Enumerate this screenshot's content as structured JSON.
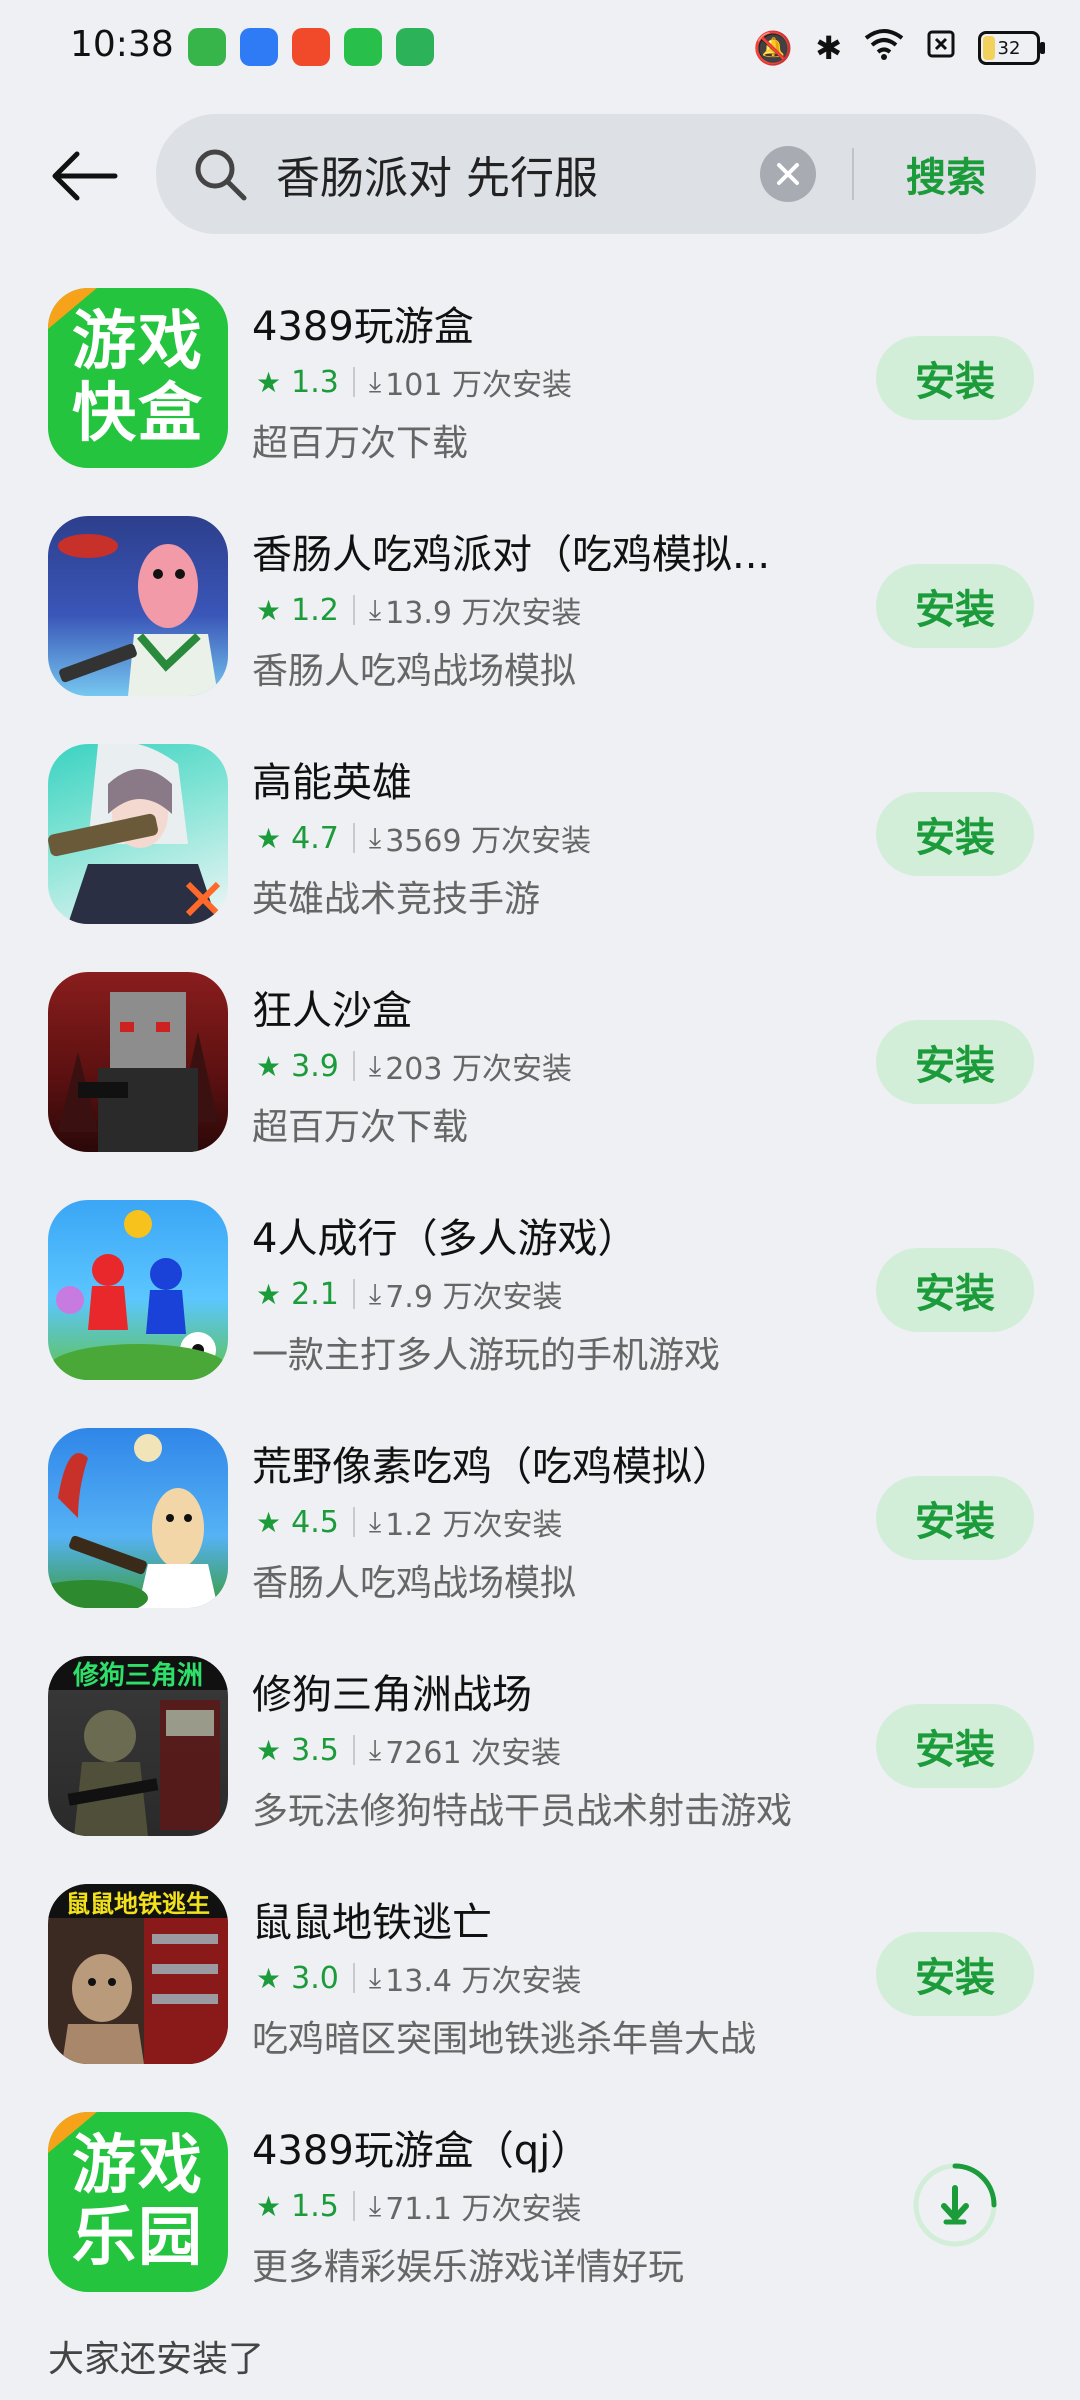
{
  "status_bar": {
    "time": "10:38",
    "notification_icons": [
      {
        "name": "app-icon-1",
        "color": "#38b54a"
      },
      {
        "name": "app-icon-2",
        "color": "#2f7bf5"
      },
      {
        "name": "app-icon-3",
        "color": "#f04a2a"
      },
      {
        "name": "app-icon-4",
        "color": "#28c04a"
      },
      {
        "name": "app-icon-5",
        "color": "#2cb35a"
      }
    ],
    "battery": "32"
  },
  "search": {
    "query": "香肠派对 先行服",
    "button_label": "搜索"
  },
  "apps": [
    {
      "name": "4389玩游盒",
      "rating": "1.3",
      "installs": "101 万次安装",
      "desc": "超百万次下载",
      "action": "安装",
      "icon": "green-text",
      "icon_l1": "游戏",
      "icon_l2": "快盒"
    },
    {
      "name": "香肠人吃鸡派对（吃鸡模拟...",
      "rating": "1.2",
      "installs": "13.9 万次安装",
      "desc": "香肠人吃鸡战场模拟",
      "action": "安装",
      "icon": "sausage"
    },
    {
      "name": "高能英雄",
      "rating": "4.7",
      "installs": "3569 万次安装",
      "desc": "英雄战术竞技手游",
      "action": "安装",
      "icon": "hero"
    },
    {
      "name": "狂人沙盒",
      "rating": "3.9",
      "installs": "203 万次安装",
      "desc": "超百万次下载",
      "action": "安装",
      "icon": "sandbox"
    },
    {
      "name": "4人成行（多人游戏）",
      "rating": "2.1",
      "installs": "7.9 万次安装",
      "desc": "一款主打多人游玩的手机游戏",
      "action": "安装",
      "icon": "multiplayer"
    },
    {
      "name": "荒野像素吃鸡（吃鸡模拟）",
      "rating": "4.5",
      "installs": "1.2 万次安装",
      "desc": "香肠人吃鸡战场模拟",
      "action": "安装",
      "icon": "pixel"
    },
    {
      "name": "修狗三角洲战场",
      "rating": "3.5",
      "installs": "7261 次安装",
      "desc": "多玩法修狗特战干员战术射击游戏",
      "action": "安装",
      "icon": "delta",
      "icon_caption": "修狗三角洲"
    },
    {
      "name": "鼠鼠地铁逃亡",
      "rating": "3.0",
      "installs": "13.4 万次安装",
      "desc": "吃鸡暗区突围地铁逃杀年兽大战",
      "action": "安装",
      "icon": "metro",
      "icon_caption": "鼠鼠地铁逃生"
    },
    {
      "name": "4389玩游盒（qj）",
      "rating": "1.5",
      "installs": "71.1 万次安装",
      "desc": "更多精彩娱乐游戏详情好玩",
      "action": "downloading",
      "icon": "green-text",
      "icon_l1": "游戏",
      "icon_l2": "乐园"
    }
  ],
  "section_title": "大家还安装了"
}
